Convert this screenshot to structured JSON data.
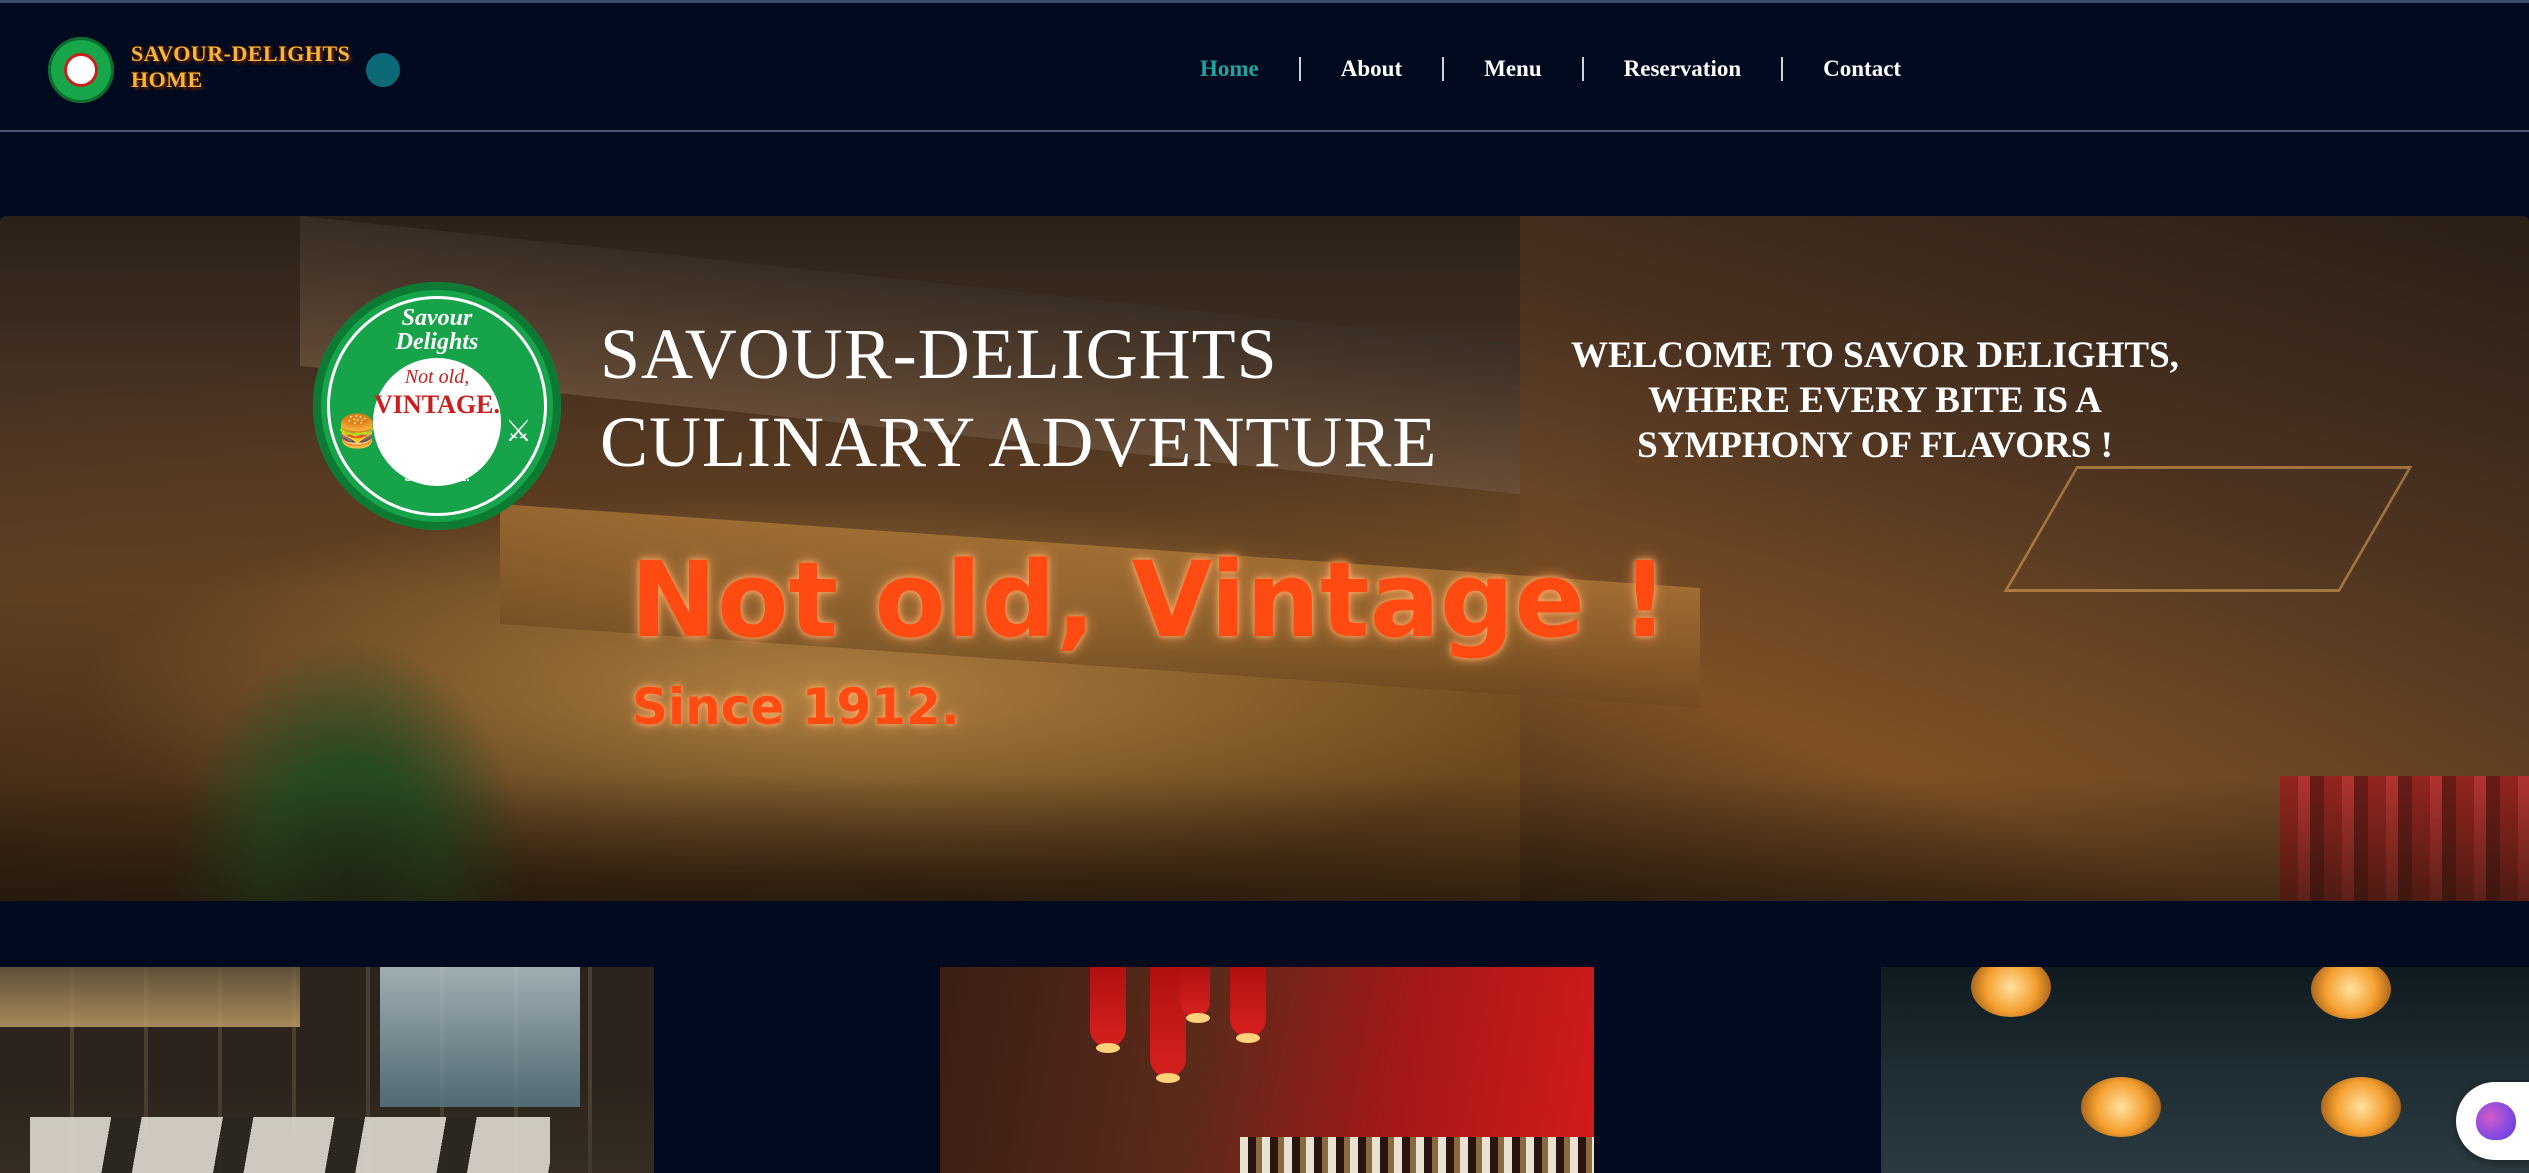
{
  "navbar": {
    "brand_name": "SAVOUR-DELIGHTS HOME",
    "items": [
      {
        "label": "Home",
        "active": true
      },
      {
        "label": "About",
        "active": false
      },
      {
        "label": "Menu",
        "active": false
      },
      {
        "label": "Reservation",
        "active": false
      },
      {
        "label": "Contact",
        "active": false
      }
    ],
    "active_color": "#1fa4a0"
  },
  "hero": {
    "logo": {
      "line1": "Savour",
      "line2": "Delights",
      "center_line1": "Not old,",
      "center_line2": "VINTAGE.",
      "since": "Since 1912."
    },
    "title_line1": "SAVOUR-DELIGHTS",
    "title_line2": "CULINARY ADVENTURE",
    "welcome_line1": "WELCOME TO SAVOR DELIGHTS,",
    "welcome_line2": "WHERE EVERY BITE IS A",
    "welcome_line3": "SYMPHONY OF FLAVORS !",
    "tagline": "Not old, Vintage !",
    "since": "Since 1912.",
    "tagline_color": "#ff4a12"
  },
  "colors": {
    "page_background": "#010a1f",
    "brand_text": "#f5b63a",
    "logo_green": "#16a34a"
  },
  "icons": {
    "chat": "brain-icon"
  }
}
